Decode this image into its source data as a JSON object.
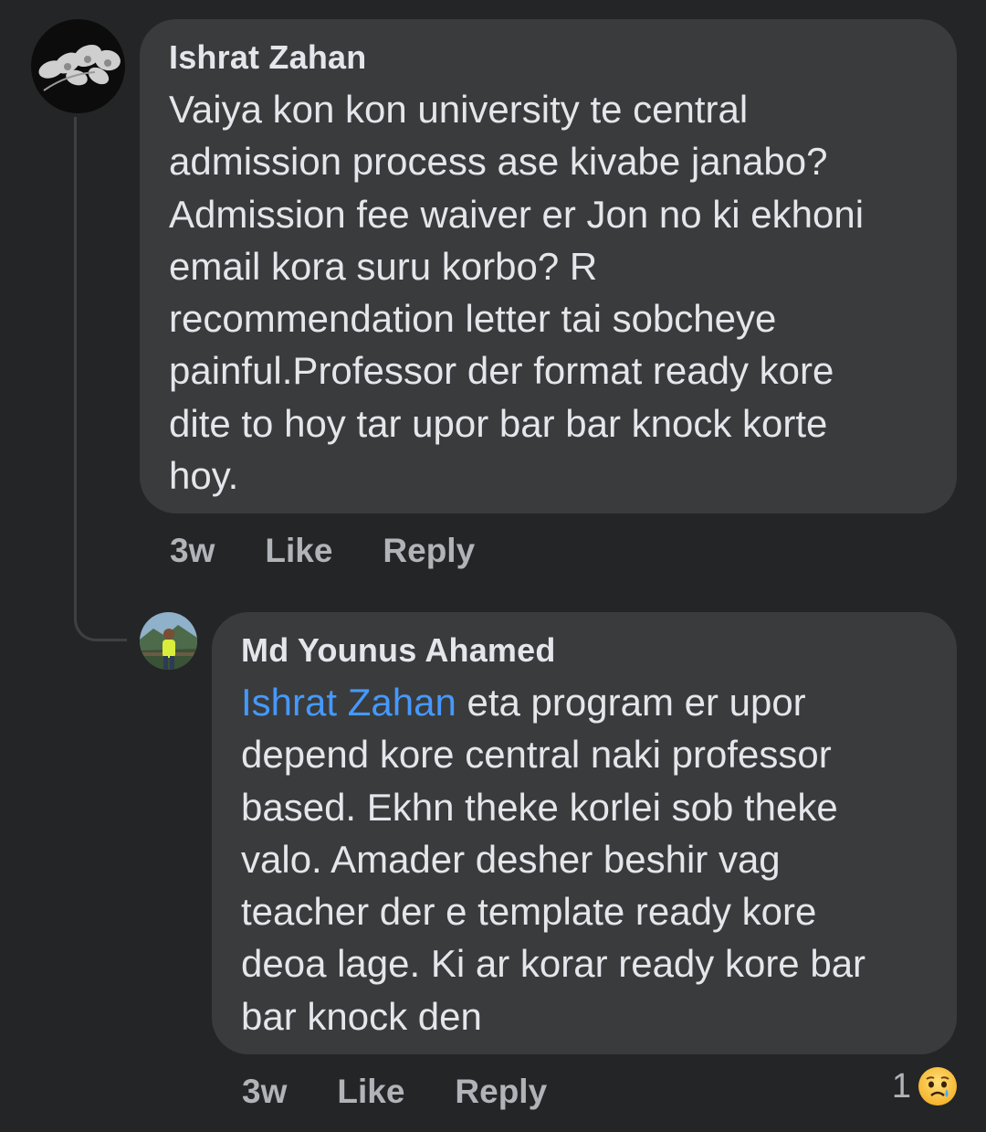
{
  "comment": {
    "author": "Ishrat Zahan",
    "text": "Vaiya kon kon university te central\nadmission process ase kivabe janabo?\nAdmission fee waiver er Jon no ki ekhoni\nemail kora suru korbo? R\nrecommendation letter tai sobcheye\npainful.Professor der format ready kore\ndite to hoy tar upor bar bar knock korte\nhoy.",
    "time": "3w",
    "like_label": "Like",
    "reply_label": "Reply"
  },
  "reply": {
    "author": "Md Younus Ahamed",
    "mention": "Ishrat Zahan",
    "text": " eta program er upor\ndepend kore central naki professor\nbased. Ekhn theke korlei sob theke\nvalo. Amader desher beshir vag\nteacher der e template ready kore\ndeoa lage. Ki ar korar ready kore bar\nbar knock den",
    "time": "3w",
    "like_label": "Like",
    "reply_label": "Reply",
    "reaction_count": "1",
    "reaction_icon": "sad-reaction-icon"
  }
}
